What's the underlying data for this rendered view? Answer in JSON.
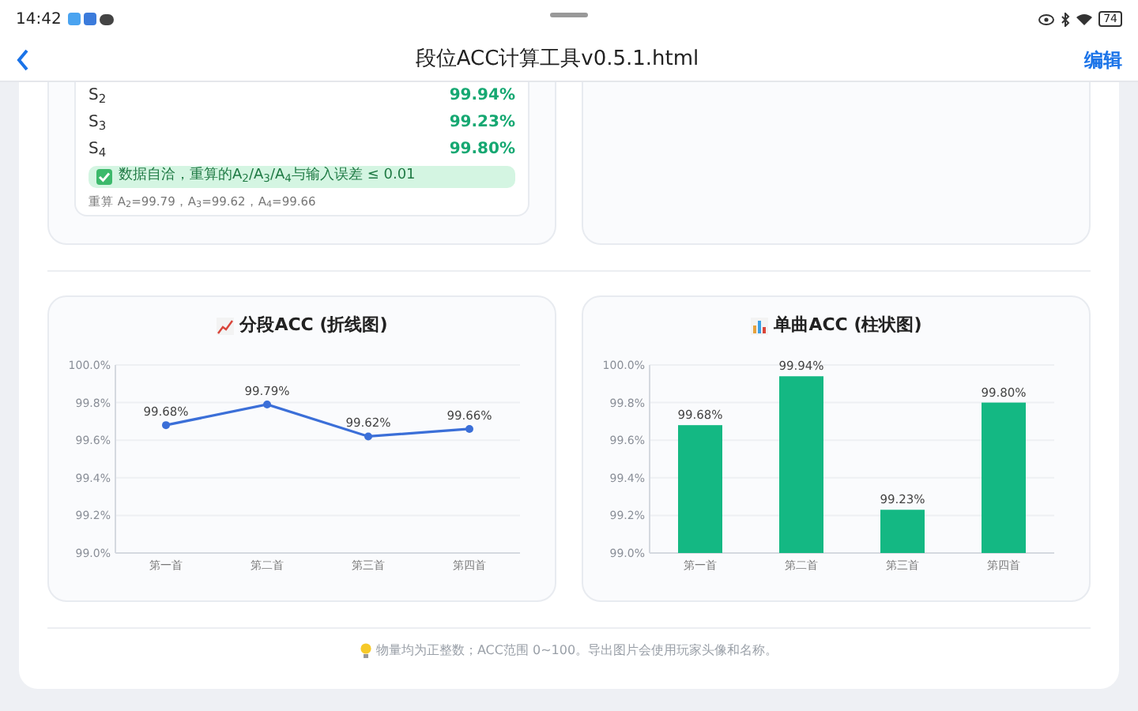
{
  "status_bar": {
    "time": "14:42",
    "battery": "74"
  },
  "nav": {
    "title": "段位ACC计算工具v0.5.1.html",
    "action": "编辑"
  },
  "segments": [
    {
      "label": "S$_{2}$",
      "value": "99.94%"
    },
    {
      "label": "S$_{3}$",
      "value": "99.23%"
    },
    {
      "label": "S$_{4}$",
      "value": "99.80%"
    }
  ],
  "check_message": "数据自洽，重算的A$_{2}$/A$_{3}$/A$_{4}$与输入误差 ≤ 0.01",
  "recalc_note": "重算 A$_{2}$=99.79，A$_{3}$=99.62，A$_{4}$=99.66",
  "charts": [
    {
      "chart_data": {
        "type": "line",
        "title": "分段ACC (折线图)",
        "categories": [
          "第一首",
          "第二首",
          "第三首",
          "第四首"
        ],
        "series": [
          {
            "color": "#3b6fd8",
            "marker": "circle",
            "values": [
              99.68,
              99.79,
              99.62,
              99.66
            ]
          }
        ],
        "grid": true,
        "ylim": [
          99,
          100
        ],
        "yticks": [
          {
            "value": 99,
            "label": "99.0%"
          },
          {
            "value": 99.2,
            "label": "99.2%"
          },
          {
            "value": 99.4,
            "label": "99.4%"
          },
          {
            "value": 99.6,
            "label": "99.6%"
          },
          {
            "value": 99.8,
            "label": "99.8%"
          },
          {
            "value": 100,
            "label": "100.0%"
          }
        ],
        "value_labels": [
          "99.68%",
          "99.79%",
          "99.62%",
          "99.66%"
        ]
      }
    },
    {
      "chart_data": {
        "type": "bar",
        "title": "单曲ACC (柱状图)",
        "categories": [
          "第一首",
          "第二首",
          "第三首",
          "第四首"
        ],
        "series": [
          {
            "color": "#14b883",
            "values": [
              99.68,
              99.94,
              99.23,
              99.8
            ]
          }
        ],
        "grid": true,
        "ylim": [
          99,
          100
        ],
        "yticks": [
          {
            "value": 99,
            "label": "99.0%"
          },
          {
            "value": 99.2,
            "label": "99.2%"
          },
          {
            "value": 99.4,
            "label": "99.4%"
          },
          {
            "value": 99.6,
            "label": "99.6%"
          },
          {
            "value": 99.8,
            "label": "99.8%"
          },
          {
            "value": 100,
            "label": "100.0%"
          }
        ],
        "value_labels": [
          "99.68%",
          "99.94%",
          "99.23%",
          "99.80%"
        ]
      }
    }
  ],
  "tip": "物量均为正整数；ACC范围 0~100。导出图片会使用玩家头像和名称。"
}
